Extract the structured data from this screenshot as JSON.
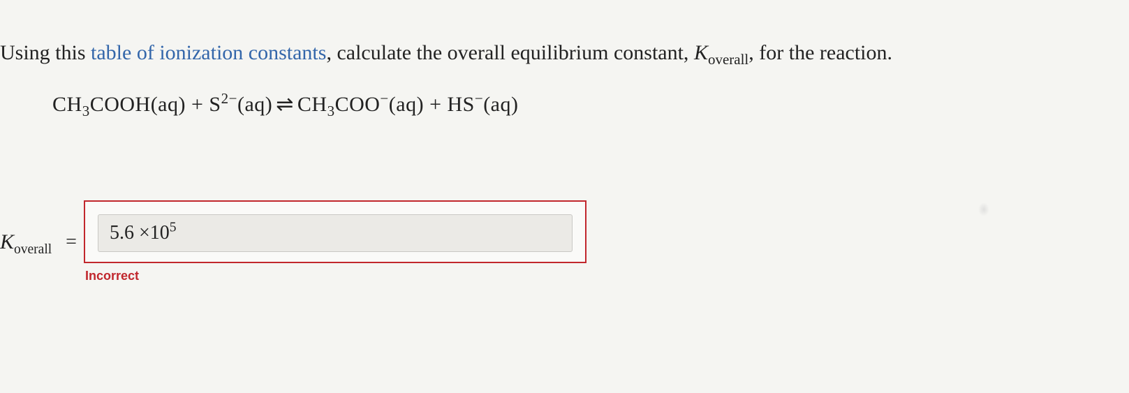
{
  "prompt": {
    "prefix": "Using this ",
    "link": "table of ionization constants",
    "middle": ", calculate the overall equilibrium constant, ",
    "kvar": "K",
    "ksub": "overall",
    "suffix": ", for the reaction."
  },
  "equation": {
    "r1_formula": "CH",
    "r1_sub": "3",
    "r1_rest": "COOH(aq)",
    "plus1": " + ",
    "r2_base": "S",
    "r2_sup": "2−",
    "r2_rest": "(aq)",
    "arrow": " ⇌ ",
    "p1_formula": "CH",
    "p1_sub": "3",
    "p1_rest": "COO",
    "p1_sup": "−",
    "p1_paren": "(aq)",
    "plus2": " + ",
    "p2_base": "HS",
    "p2_sup": "−",
    "p2_rest": "(aq)"
  },
  "answer": {
    "k_label": "K",
    "k_sub": "overall",
    "equals": "=",
    "value_coef": "5.6",
    "value_times": " ×10",
    "value_exp": "5",
    "feedback": "Incorrect"
  }
}
